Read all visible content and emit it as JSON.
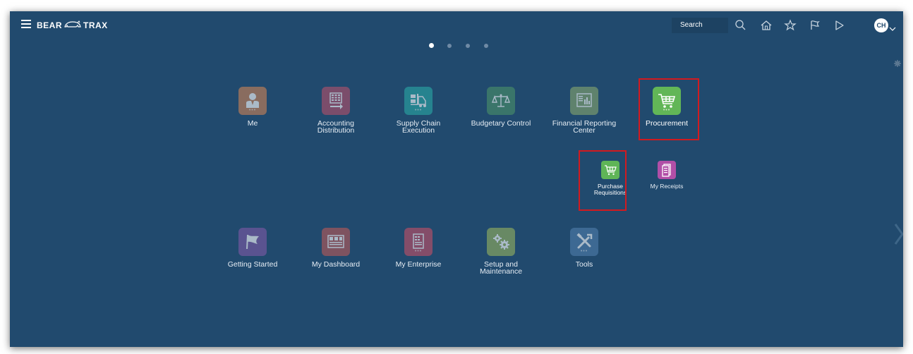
{
  "header": {
    "brand_left": "BEAR",
    "brand_right": "TRAX",
    "search_label": "Search",
    "avatar_initials": "CH"
  },
  "carousel": {
    "pages": 4,
    "active": 0
  },
  "colors": {
    "background": "#214a6e",
    "highlight": "#d21a1f"
  },
  "apps": [
    {
      "label": "Me",
      "color": "#c98256",
      "icon": "person-icon"
    },
    {
      "label": "Accounting Distribution",
      "color": "#b2506a",
      "icon": "ledger-icon"
    },
    {
      "label": "Supply Chain Execution",
      "color": "#2aa6a4",
      "icon": "forklift-icon"
    },
    {
      "label": "Budgetary Control",
      "color": "#4a9068",
      "icon": "scale-icon"
    },
    {
      "label": "Financial Reporting Center",
      "color": "#85a56d",
      "icon": "report-icon"
    },
    {
      "label": "Procurement",
      "color": "#62b657",
      "icon": "cart-icon"
    }
  ],
  "sub_apps": [
    {
      "label": "Purchase Requisitions",
      "color": "#5fb557",
      "icon": "cart-icon"
    },
    {
      "label": "My Receipts",
      "color": "#b14fa7",
      "icon": "receipt-icon"
    }
  ],
  "apps_row2": [
    {
      "label": "Getting Started",
      "color": "#7d5aa6",
      "icon": "flag-icon"
    },
    {
      "label": "My Dashboard",
      "color": "#b85a58",
      "icon": "dashboard-icon"
    },
    {
      "label": "My Enterprise",
      "color": "#c14f67",
      "icon": "building-icon"
    },
    {
      "label": "Setup and Maintenance",
      "color": "#94b15e",
      "icon": "gears-icon"
    },
    {
      "label": "Tools",
      "color": "#4f7cab",
      "icon": "tools-icon"
    }
  ]
}
